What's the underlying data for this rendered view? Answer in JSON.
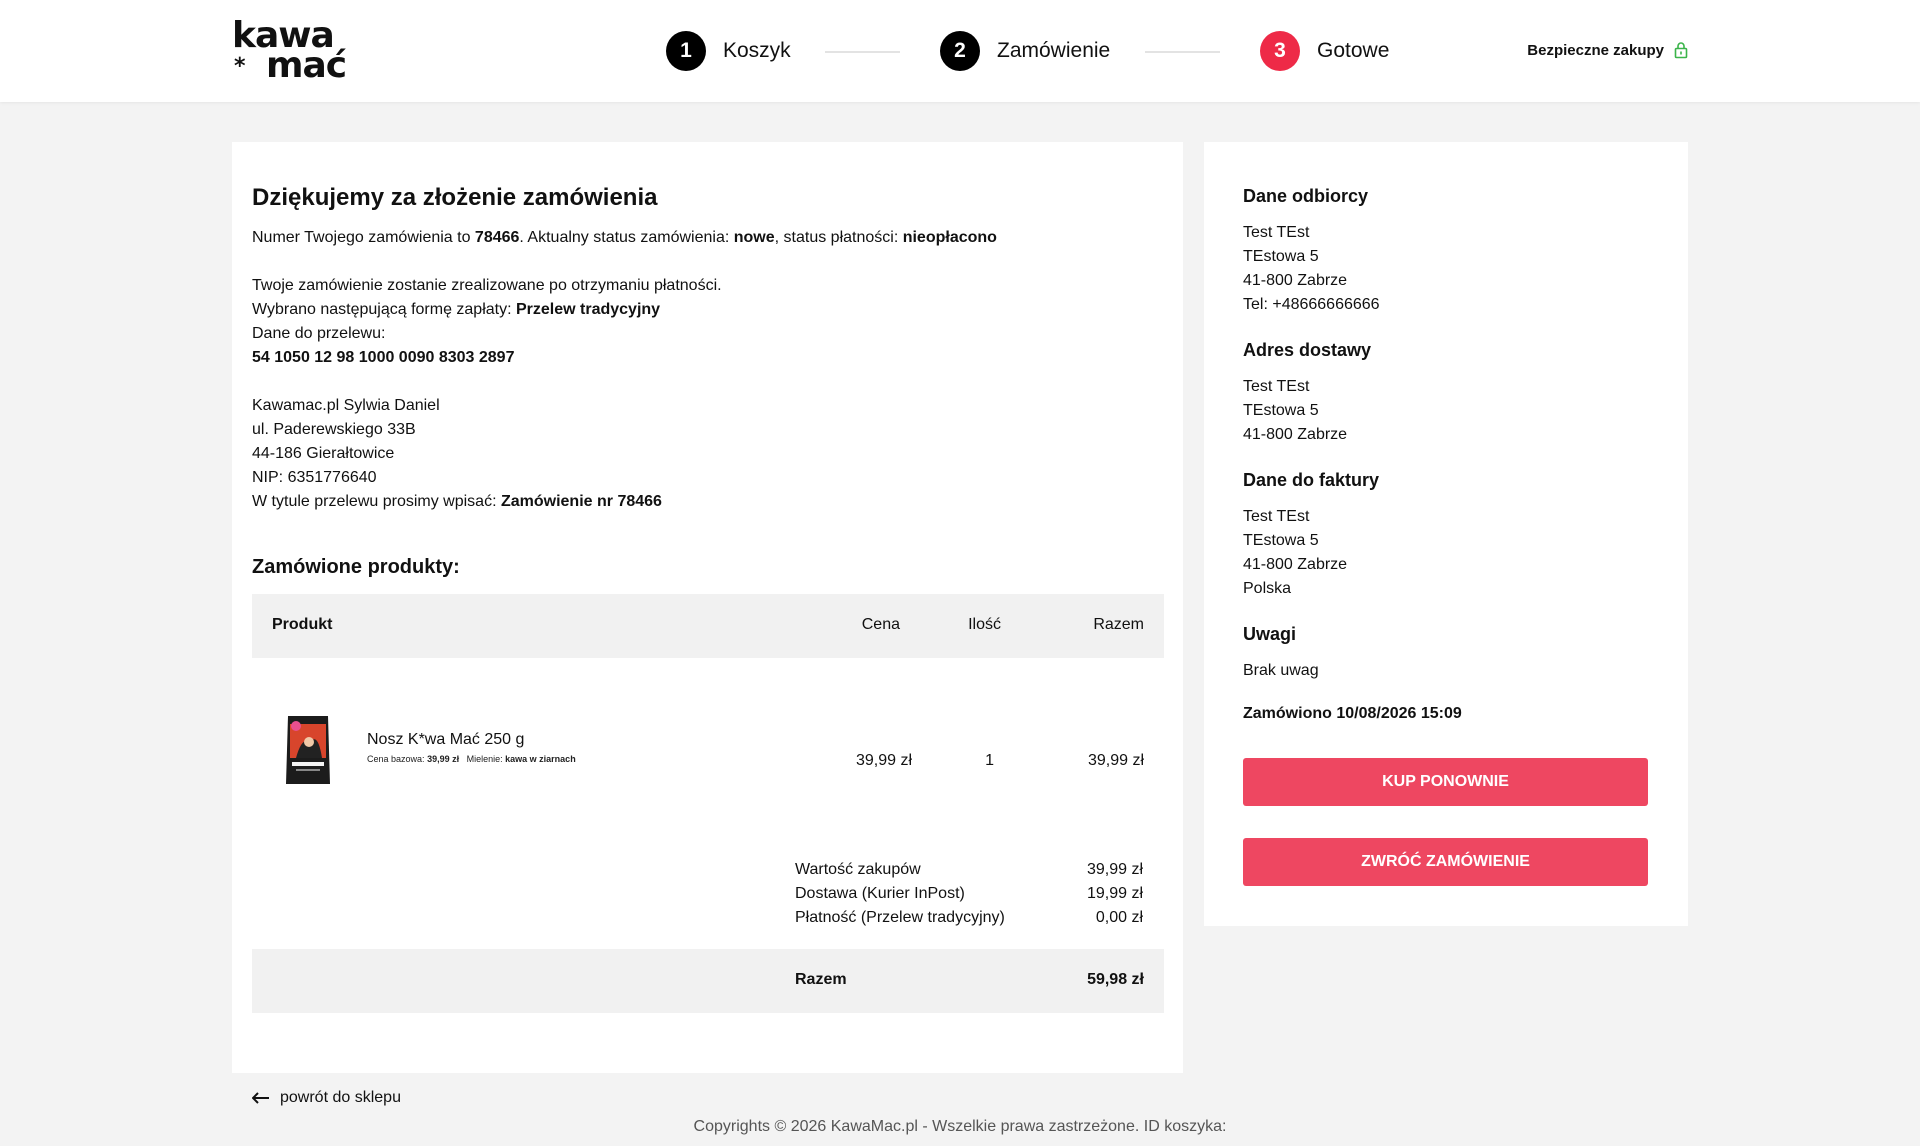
{
  "brand": {
    "logo_line1": "kawa",
    "logo_star": "*",
    "logo_line2": "mać",
    "accent": "#ee2a47",
    "button_color": "#ee4761"
  },
  "steps": [
    {
      "num": "1",
      "label": "Koszyk"
    },
    {
      "num": "2",
      "label": "Zamówienie"
    },
    {
      "num": "3",
      "label": "Gotowe"
    }
  ],
  "secure_label": "Bezpieczne zakupy",
  "confirmation": {
    "title": "Dziękujemy za złożenie zamówienia",
    "order_prefix": "Numer Twojego zamówienia to ",
    "order_number": "78466",
    "status_prefix": ". Aktualny status zamówienia: ",
    "status": "nowe",
    "payment_status_prefix": ", status płatności: ",
    "payment_status": "nieopłacono",
    "realize_note": "Twoje zamówienie zostanie zrealizowane po otrzymaniu płatności.",
    "payment_form_prefix": "Wybrano następującą formę zapłaty: ",
    "payment_form": "Przelew tradycyjny",
    "transfer_data_label": "Dane do przelewu:",
    "account_number": "54 1050 12 98 1000 0090 8303 2897",
    "company": "Kawamac.pl Sylwia Daniel",
    "street": "ul. Paderewskiego 33B",
    "city": "44-186 Gierałtowice",
    "nip": "NIP: 6351776640",
    "transfer_title_prefix": "W tytule przelewu prosimy wpisać: ",
    "transfer_title": "Zamówienie nr 78466"
  },
  "products_section": {
    "title": "Zamówione produkty:",
    "headers": {
      "product": "Produkt",
      "price": "Cena",
      "qty": "Ilość",
      "total": "Razem"
    },
    "items": [
      {
        "name": "Nosz K*wa Mać 250 g",
        "base_price_label": "Cena bazowa:",
        "base_price": "39,99 zł",
        "grind_label": "Mielenie:",
        "grind": "kawa w ziarnach",
        "price": "39,99 zł",
        "qty": "1",
        "total": "39,99 zł"
      }
    ]
  },
  "summary": {
    "purchase_label": "Wartość zakupów",
    "purchase_value": "39,99 zł",
    "delivery_label": "Dostawa (Kurier InPost)",
    "delivery_value": "19,99 zł",
    "payment_label": "Płatność (Przelew tradycyjny)",
    "payment_value": "0,00 zł",
    "total_label": "Razem",
    "total_value": "59,98 zł"
  },
  "sidebar": {
    "recipient_title": "Dane odbiorcy",
    "recipient": [
      "Test TEst",
      "TEstowa 5",
      "41-800 Zabrze",
      "Tel: +48666666666"
    ],
    "delivery_title": "Adres dostawy",
    "delivery": [
      "Test TEst",
      "TEstowa 5",
      "41-800 Zabrze"
    ],
    "invoice_title": "Dane do faktury",
    "invoice": [
      "Test TEst",
      "TEstowa 5",
      "41-800 Zabrze",
      "Polska"
    ],
    "notes_title": "Uwagi",
    "notes": "Brak uwag",
    "ordered_at": "Zamówiono 10/08/2026 15:09",
    "buy_again_label": "KUP PONOWNIE",
    "return_label": "ZWRÓĆ ZAMÓWIENIE"
  },
  "back_label": "powrót do sklepu",
  "footer": "Copyrights © 2026 KawaMac.pl - Wszelkie prawa zastrzeżone. ID koszyka:"
}
